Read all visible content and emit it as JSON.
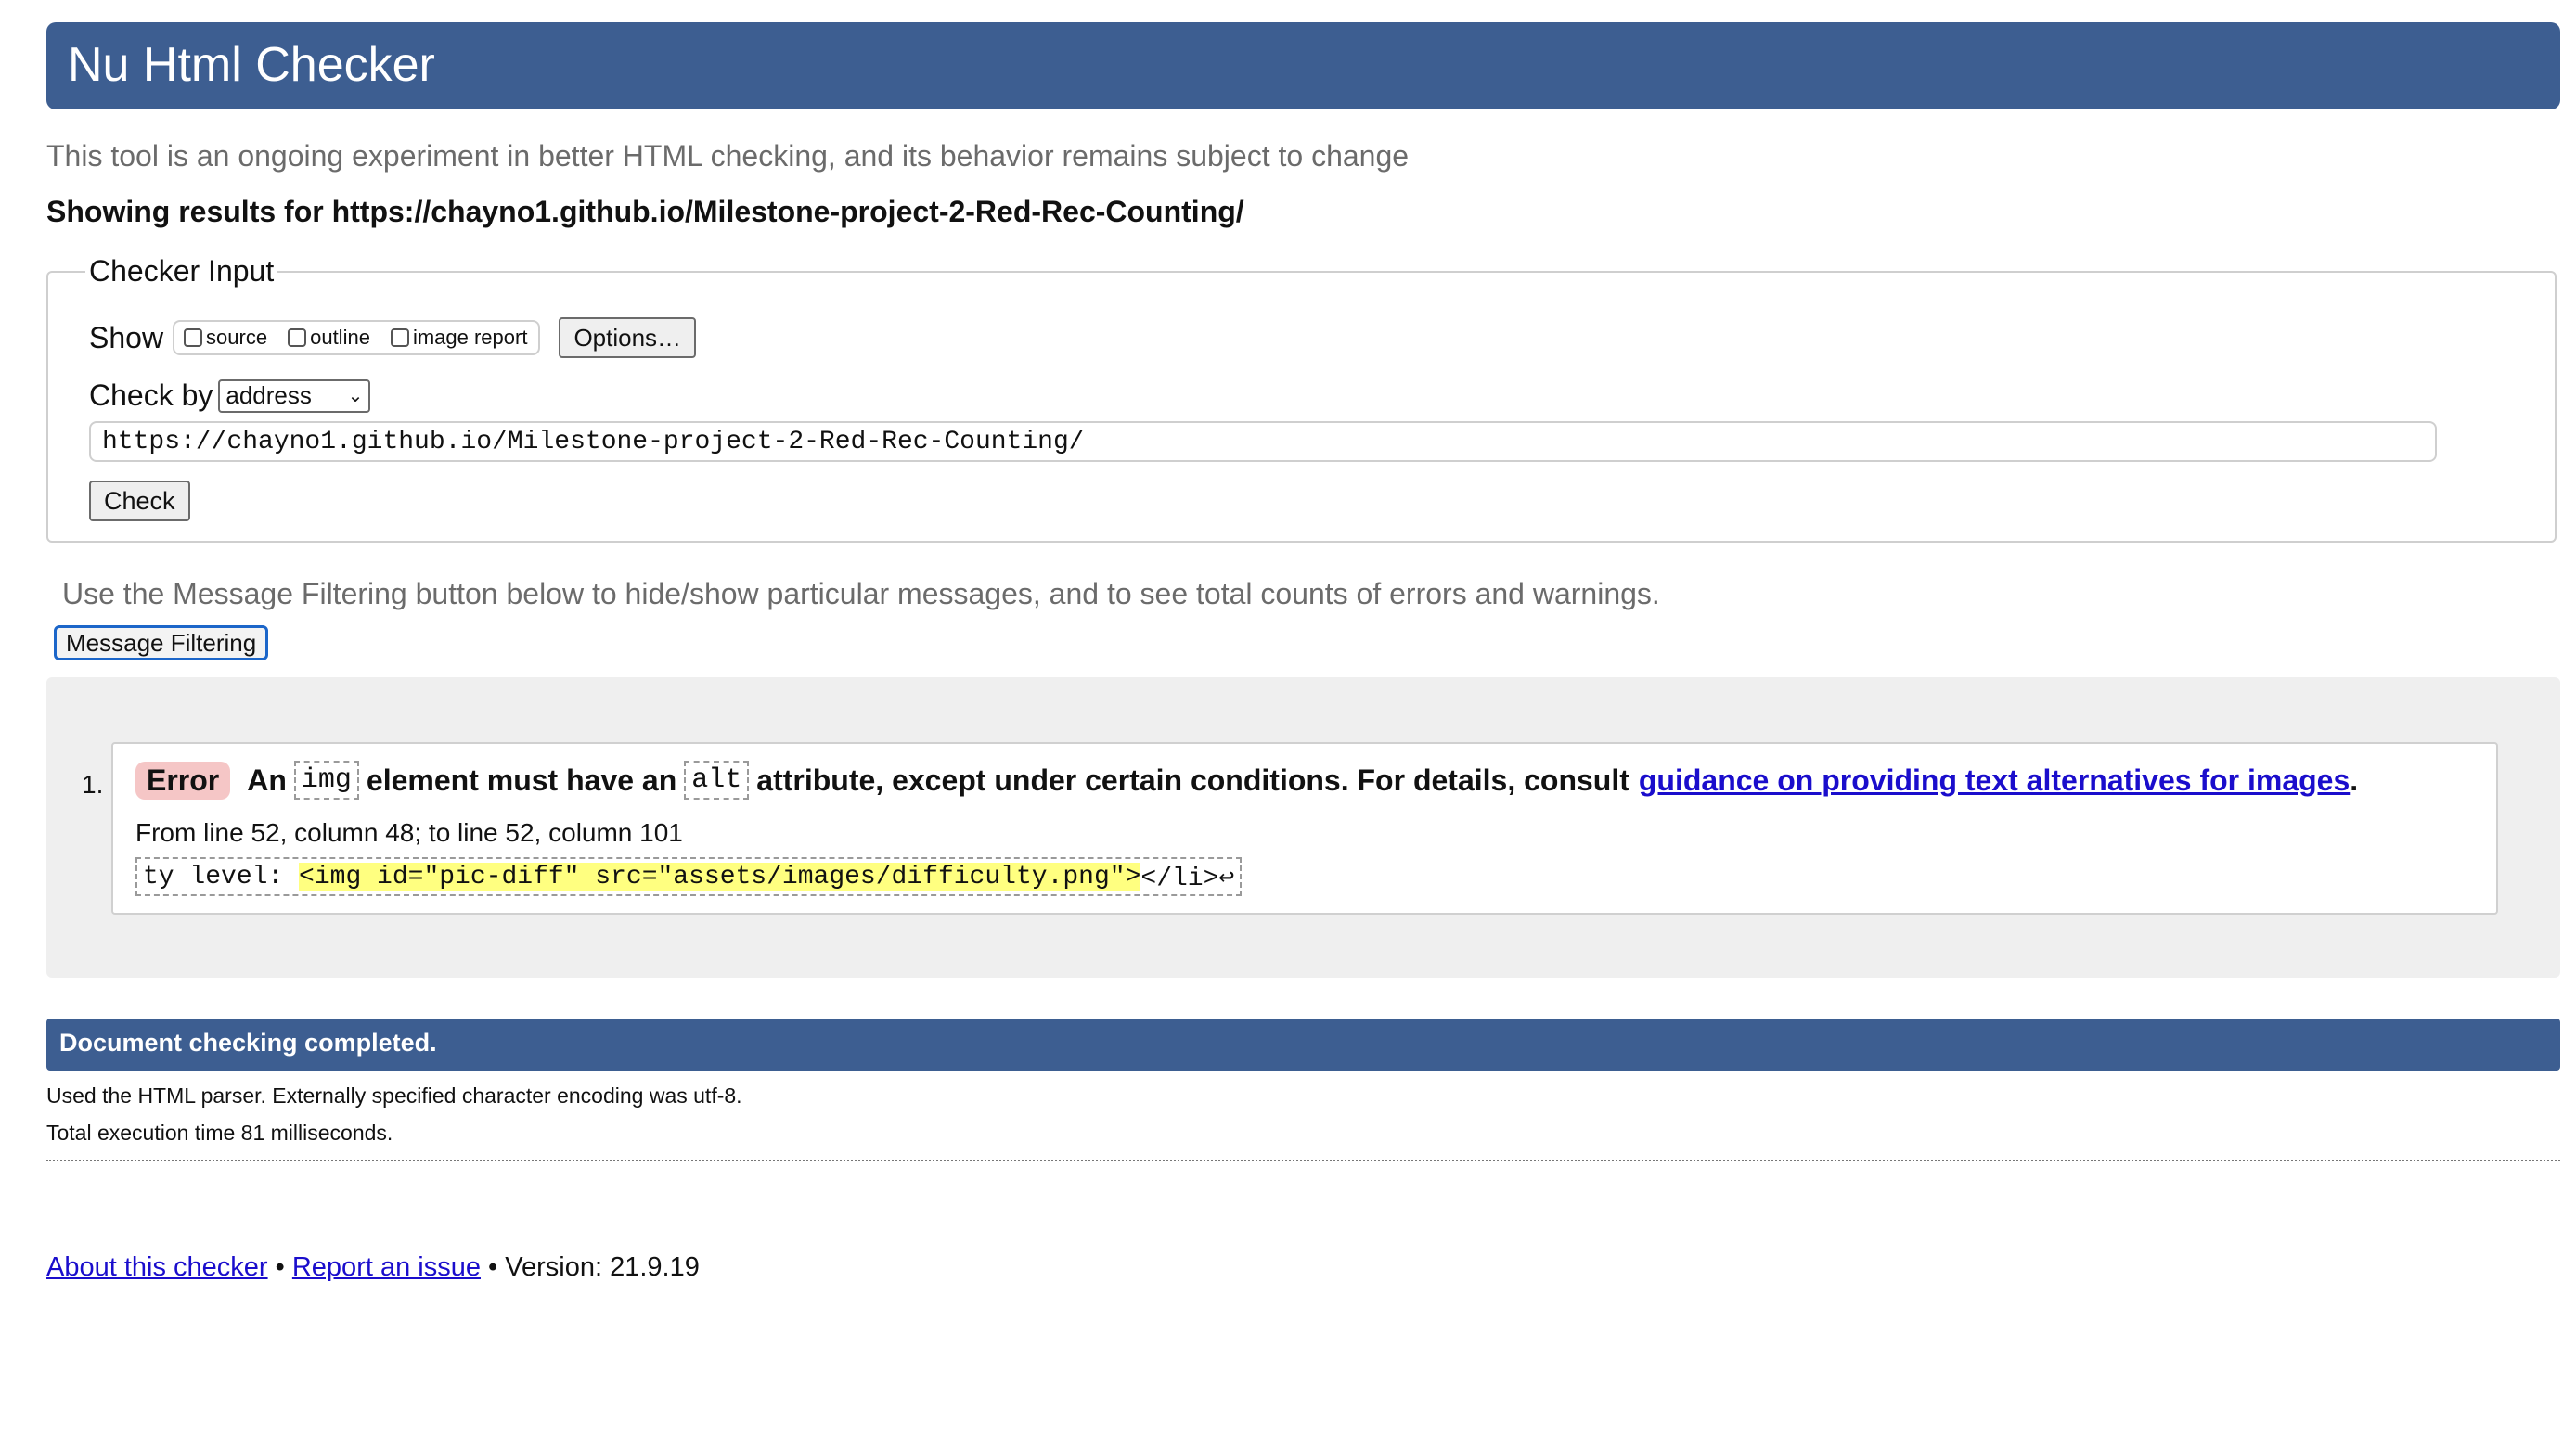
{
  "header": {
    "title": "Nu Html Checker"
  },
  "subtitle": "This tool is an ongoing experiment in better HTML checking, and its behavior remains subject to change",
  "showing_results": "Showing results for https://chayno1.github.io/Milestone-project-2-Red-Rec-Counting/",
  "checker_input": {
    "legend": "Checker Input",
    "show_label": "Show",
    "checkboxes": [
      {
        "label": "source",
        "checked": false
      },
      {
        "label": "outline",
        "checked": false
      },
      {
        "label": "image report",
        "checked": false
      }
    ],
    "options_button": "Options…",
    "check_by_label": "Check by",
    "check_by_value": "address",
    "url_value": "https://chayno1.github.io/Milestone-project-2-Red-Rec-Counting/",
    "check_button": "Check"
  },
  "filter_hint": "Use the Message Filtering button below to hide/show particular messages, and to see total counts of errors and warnings.",
  "filter_button": "Message Filtering",
  "messages": [
    {
      "number": "1.",
      "type": "Error",
      "text_1": "An",
      "code_1": "img",
      "text_2": "element must have an",
      "code_2": "alt",
      "text_3": "attribute, except under certain conditions. For details, consult",
      "link": "guidance on providing text alternatives for images",
      "text_4": ".",
      "location": "From line 52, column 48; to line 52, column 101",
      "extract_before": "ty level: ",
      "extract_highlight": "<img id=\"pic-diff\" src=\"assets/images/difficulty.png\">",
      "extract_after": "</li>↩"
    }
  ],
  "completion": {
    "title": "Document checking completed.",
    "parser_info": "Used the HTML parser. Externally specified character encoding was utf-8.",
    "execution_time": "Total execution time 81 milliseconds."
  },
  "footer": {
    "about_link": "About this checker",
    "sep": " • ",
    "report_link": "Report an issue",
    "version": "Version: 21.9.19"
  },
  "colors": {
    "header_bg": "#3d5e91",
    "error_badge": "#f5c6c6",
    "highlight": "#ffff80",
    "link": "#1a0dcc"
  }
}
